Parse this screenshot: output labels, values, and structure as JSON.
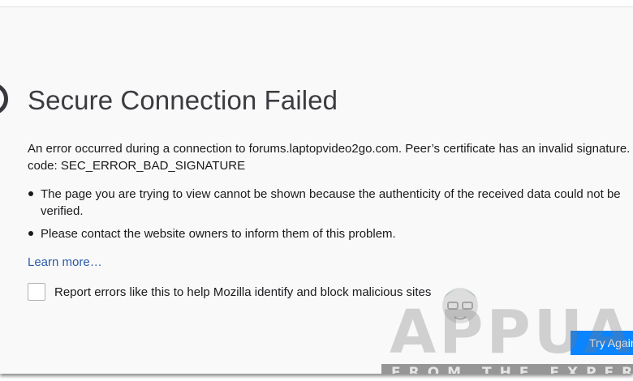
{
  "error_page": {
    "title": "Secure Connection Failed",
    "description_line1": "An error occurred during a connection to forums.laptopvideo2go.com. Peer’s certificate has an invalid signature.",
    "description_line2": "code: SEC_ERROR_BAD_SIGNATURE",
    "bullets": [
      {
        "line1": "The page you are trying to view cannot be shown because the authenticity of the received data could not be",
        "line2": "verified."
      },
      {
        "line1": "Please contact the website owners to inform them of this problem."
      }
    ],
    "learn_more_label": "Learn more…",
    "report_checkbox_label": "Report errors like this to help Mozilla identify and block malicious sites",
    "report_checked": false,
    "try_again_label": "Try Again",
    "icon": "error-icon"
  },
  "watermark": {
    "text": "APPUALS",
    "tagline": "FROM THE EXPERTS!"
  },
  "colors": {
    "page_background": "#f9f9fa",
    "title": "#3b3b40",
    "link": "#2b5aa8",
    "primary_button": "#0a84ff"
  }
}
